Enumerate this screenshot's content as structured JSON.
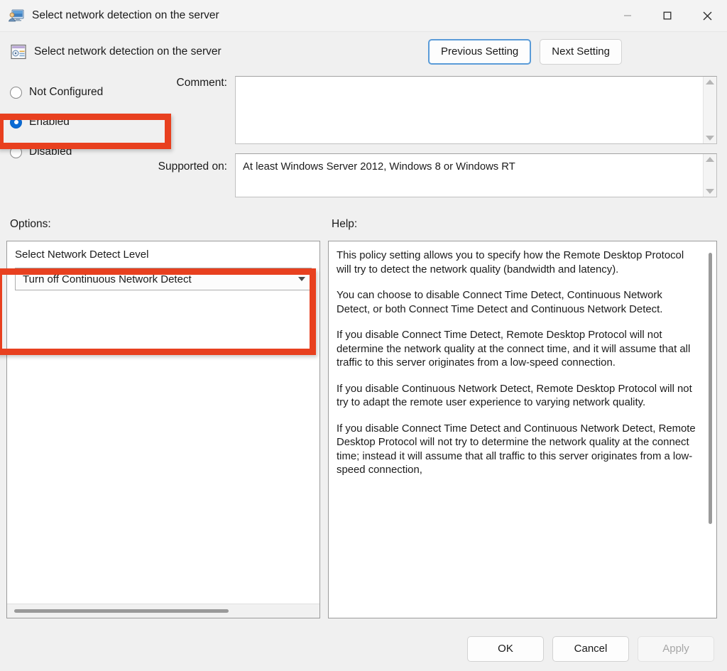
{
  "window": {
    "title": "Select network detection on the server",
    "icon": "remote-desktop-icon",
    "minimize_label": "–",
    "maximize_label": "□",
    "close_label": "✕"
  },
  "header": {
    "title": "Select network detection on the server",
    "icon": "policy-setting-icon",
    "previous_button": "Previous Setting",
    "next_button": "Next Setting"
  },
  "state": {
    "options": [
      {
        "label": "Not Configured",
        "selected": false
      },
      {
        "label": "Enabled",
        "selected": true
      },
      {
        "label": "Disabled",
        "selected": false
      }
    ]
  },
  "comment": {
    "label": "Comment:",
    "value": ""
  },
  "supported": {
    "label": "Supported on:",
    "value": "At least Windows Server 2012, Windows 8 or Windows RT"
  },
  "options_pane": {
    "section_label": "Options:",
    "setting_label": "Select Network Detect Level",
    "combo_value": "Turn off Continuous Network Detect"
  },
  "help_pane": {
    "section_label": "Help:",
    "paragraphs": [
      "This policy setting allows you to specify how the Remote Desktop Protocol will try to detect the network quality (bandwidth and latency).",
      "You can choose to disable Connect Time Detect, Continuous Network Detect, or both Connect Time Detect and Continuous Network Detect.",
      "If you disable Connect Time Detect, Remote Desktop Protocol will not determine the network quality at the connect time, and it will assume that all traffic to this server originates from a low-speed connection.",
      "If you disable Continuous Network Detect, Remote Desktop Protocol will not try to adapt the remote user experience to varying network quality.",
      "If you disable Connect Time Detect and Continuous Network Detect, Remote Desktop Protocol will not try to determine the network quality at the connect time; instead it will assume that all traffic to this server originates from a low-speed connection,"
    ]
  },
  "footer": {
    "ok": "OK",
    "cancel": "Cancel",
    "apply": "Apply"
  },
  "annotations": {
    "color": "#e8401f",
    "highlighted": [
      "enabled-radio-row",
      "options-setting-group"
    ]
  }
}
